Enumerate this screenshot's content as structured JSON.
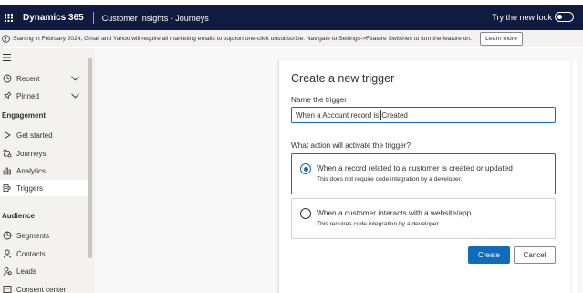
{
  "header": {
    "brand": "Dynamics 365",
    "app_name": "Customer Insights - Journeys",
    "try_new_look": "Try the new look"
  },
  "notice": {
    "text": "Starting in February 2024, Gmail and Yahoo will require all marketing emails to support one-click unsubscribe. Navigate to Settings->Feature Switches to turn the feature on.",
    "learn_more": "Learn more"
  },
  "sidebar": {
    "recent": "Recent",
    "pinned": "Pinned",
    "engagement_header": "Engagement",
    "engagement_items": [
      {
        "label": "Get started",
        "icon": "play-icon"
      },
      {
        "label": "Journeys",
        "icon": "journey-icon"
      },
      {
        "label": "Analytics",
        "icon": "analytics-icon"
      },
      {
        "label": "Triggers",
        "icon": "trigger-icon"
      }
    ],
    "audience_header": "Audience",
    "audience_items": [
      {
        "label": "Segments",
        "icon": "segments-icon"
      },
      {
        "label": "Contacts",
        "icon": "person-icon"
      },
      {
        "label": "Leads",
        "icon": "leads-icon"
      },
      {
        "label": "Consent center",
        "icon": "consent-icon"
      }
    ]
  },
  "panel": {
    "title": "Create a new trigger",
    "name_label": "Name the trigger",
    "name_value_before_caret": "When a Account record is ",
    "name_value_after_caret": "Created",
    "action_label": "What action will activate the trigger?",
    "options": [
      {
        "title": "When a record related to a customer is created or updated",
        "subtitle": "This does not require code integration by a developer.",
        "selected": true
      },
      {
        "title": "When a customer interacts with a website/app",
        "subtitle": "This requires code integration by a developer.",
        "selected": false
      }
    ],
    "create_label": "Create",
    "cancel_label": "Cancel"
  },
  "colors": {
    "topbar": "#0f1c3f",
    "accent": "#0f6cbd",
    "sidebar_bg": "#f3f2f1"
  }
}
